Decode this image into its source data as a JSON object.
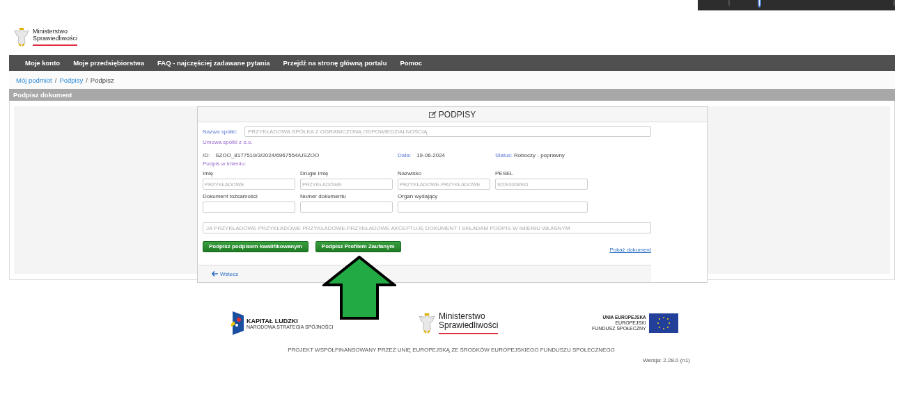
{
  "header": {
    "logo_line1": "Ministerstwo",
    "logo_line2": "Sprawiedliwości"
  },
  "nav": [
    "Moje konto",
    "Moje przedsiębiorstwa",
    "FAQ - najczęściej zadawane pytania",
    "Przejdź na stronę główną portalu",
    "Pomoc"
  ],
  "breadcrumb": [
    {
      "label": "Mój podmiot",
      "link": true
    },
    {
      "separator": "/",
      "label": "Podpisy",
      "link": true
    },
    {
      "separator": "/",
      "label": "Podpisz",
      "link": false
    }
  ],
  "section_title": "Podpisz dokument",
  "card": {
    "title": "PODPISY",
    "company_label": "Nazwa spółki:",
    "company_placeholder": "PRZYKŁADOWA SPÓŁKA Z OGRANICZONĄ ODPOWIEDZIALNOŚCIĄ",
    "document_type": "Umowa spółki z o.o.",
    "id_label": "ID:",
    "id_value": "SZOO_8177519/3/2024/6967554/USZOO",
    "date_label": "Data:",
    "date_value": "19-06-2024",
    "status_label": "Status:",
    "status_value": "Roboczy - poprawny",
    "signer_label": "Podpis w imieniu:",
    "fields": [
      {
        "label": "Imię",
        "placeholder": "PRZYKŁADOWE"
      },
      {
        "label": "Drugie imię",
        "placeholder": "PRZYKŁADOWE"
      },
      {
        "label": "Nazwisko",
        "placeholder": "PRZYKŁADOWE-PRZYKŁADOWE"
      },
      {
        "label": "PESEL",
        "placeholder": "92093008931"
      },
      {
        "label": "Dokument tożsamości"
      },
      {
        "label": "Numer dokumentu"
      },
      {
        "label": "Organ wydający"
      }
    ],
    "statement_placeholder": "JA PRZYKŁADOWE PRZYKŁADOWE PRZYKŁADOWE-PRZYKŁADOWE AKCEPTUJĘ DOKUMENT I SKŁADAM PODPIS W IMIENIU WŁASNYM",
    "buttons": [
      "Podpisz podpisem kwalifikowanym",
      "Podpisz Profilem Zaufanym"
    ],
    "show_document_link": "Pokaż dokument",
    "back_link": "Wstecz"
  },
  "footer": {
    "kl_title": "KAPITAŁ LUDZKI",
    "kl_sub": "NARODOWA STRATEGIA SPÓJNOŚCI",
    "ms_line1": "Ministerstwo",
    "ms_line2": "Sprawiedliwości",
    "eu_title": "UNIA EUROPEJSKA",
    "eu_line2": "EUROPEJSKI",
    "eu_line3": "FUNDUSZ SPOŁECZNY",
    "project_text": "PROJEKT WSPÓŁFINANSOWANY PRZEZ UNIĘ EUROPEJSKĄ ZE ŚRODKÓW EUROPEJSKIEGO FUNDUSZU SPOŁECZNEGO",
    "version": "Wersja: 2.28.0 (n1)"
  }
}
